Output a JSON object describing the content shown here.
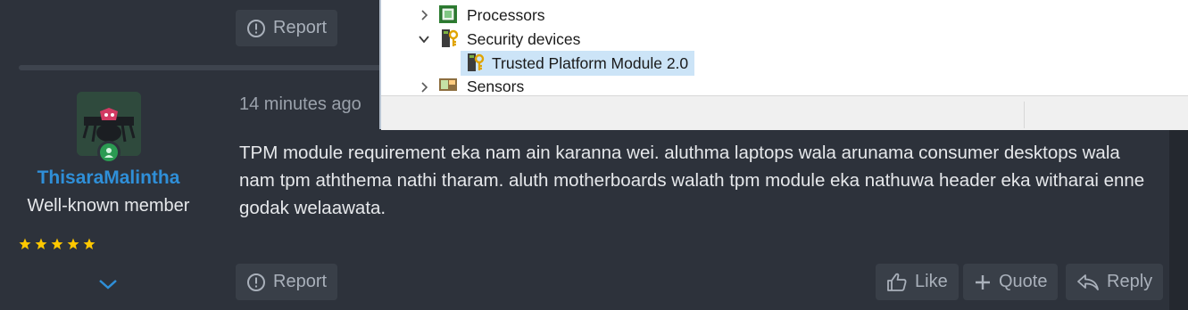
{
  "colors": {
    "page_bg": "#24282f",
    "post_bg": "#2d323b",
    "button_bg": "#393f48",
    "button_text": "#a9b0ba",
    "username": "#2f8fd8",
    "star": "#ffc800",
    "online": "#2b9a52"
  },
  "top_post": {
    "report_label": "Report",
    "report_icon": "alert-circle-icon"
  },
  "post": {
    "author": {
      "username": "ThisaraMalintha",
      "title": "Well-known member",
      "rating_stars": 5,
      "online": true
    },
    "timestamp": "14 minutes ago",
    "message": "TPM module requirement eka nam ain karanna wei. aluthma laptops wala arunama consumer desktops wala nam tpm aththema nathi tharam. aluth motherboards walath tpm module eka nathuwa header eka witharai enne godak welaawata.",
    "actions": {
      "report_label": "Report",
      "like_label": "Like",
      "quote_label": "Quote",
      "reply_label": "Reply"
    }
  },
  "device_manager": {
    "items": [
      {
        "label": "Processors",
        "expanded": false,
        "icon": "processor-chip-icon"
      },
      {
        "label": "Security devices",
        "expanded": true,
        "icon": "security-key-icon"
      },
      {
        "label": "Trusted Platform Module 2.0",
        "selected": true,
        "icon": "security-key-icon"
      },
      {
        "label": "Sensors",
        "expanded": false,
        "icon": "sensor-icon"
      }
    ]
  }
}
